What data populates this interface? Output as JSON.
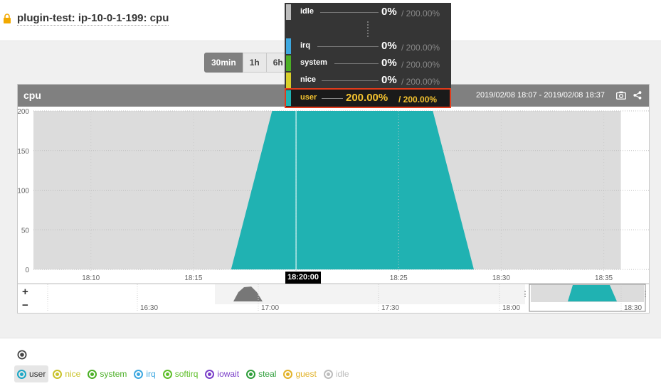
{
  "header": {
    "title": "plugin-test: ip-10-0-1-199: cpu"
  },
  "time_ranges": [
    {
      "label": "30min",
      "active": true
    },
    {
      "label": "1h",
      "active": false
    },
    {
      "label": "6h",
      "active": false
    }
  ],
  "chart_panel": {
    "title": "cpu",
    "time_range": "2019/02/08 18:07 - 2019/02/08 18:37"
  },
  "cursor_time": "18:20:00",
  "tooltip": {
    "rows": [
      {
        "name": "idle",
        "value": "0%",
        "max": "/ 200.00%",
        "color": "#bdbdbd",
        "highlighted": false
      },
      {
        "name": "irq",
        "value": "0%",
        "max": "/ 200.00%",
        "color": "#3ea8e0",
        "highlighted": false
      },
      {
        "name": "system",
        "value": "0%",
        "max": "/ 200.00%",
        "color": "#4caf26",
        "highlighted": false
      },
      {
        "name": "nice",
        "value": "0%",
        "max": "/ 200.00%",
        "color": "#d8cf2a",
        "highlighted": false
      },
      {
        "name": "user",
        "value": "200.00%",
        "max": "/ 200.00%",
        "color": "#20b2b2",
        "highlighted": true
      }
    ]
  },
  "chart_data": {
    "type": "area",
    "x_ticks": [
      "18:10",
      "18:15",
      "18:20",
      "18:25",
      "18:30",
      "18:35"
    ],
    "y_ticks": [
      0,
      50,
      100,
      150,
      200
    ],
    "ylim": [
      0,
      200
    ],
    "series": [
      {
        "name": "user",
        "x": [
          "18:16:50",
          "18:18:50",
          "18:26:40",
          "18:28:40"
        ],
        "values": [
          0,
          200,
          200,
          0
        ],
        "color": "#20b2b2"
      }
    ],
    "idle_band": {
      "values": [
        200
      ],
      "color": "#dcdcdc"
    },
    "grid": true
  },
  "navigator": {
    "x_ticks": [
      "16:30",
      "17:00",
      "17:30",
      "18:00",
      "18:30"
    ],
    "zoom_in": "+",
    "zoom_out": "−"
  },
  "legend": {
    "items": [
      {
        "label": "user",
        "color": "#1aa7c6",
        "selected": true
      },
      {
        "label": "nice",
        "color": "#c9c22a",
        "selected": false
      },
      {
        "label": "system",
        "color": "#4caf26",
        "selected": false
      },
      {
        "label": "irq",
        "color": "#3ea8e0",
        "selected": false
      },
      {
        "label": "softirq",
        "color": "#5fbf2a",
        "selected": false
      },
      {
        "label": "iowait",
        "color": "#7b3fc9",
        "selected": false
      },
      {
        "label": "steal",
        "color": "#2e9e3a",
        "selected": false
      },
      {
        "label": "guest",
        "color": "#e2b32a",
        "selected": false
      },
      {
        "label": "idle",
        "color": "#bdbdbd",
        "selected": false
      }
    ]
  }
}
